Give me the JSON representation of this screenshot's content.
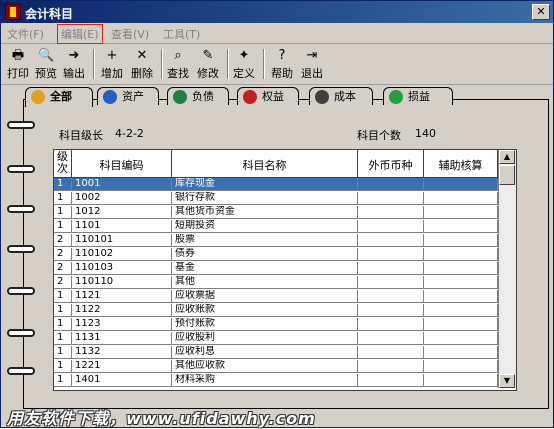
{
  "window": {
    "title": "会计科目",
    "close_label": "✕"
  },
  "menu": [
    {
      "label": "文件(F)"
    },
    {
      "label": "编辑(E)"
    },
    {
      "label": "查看(V)"
    },
    {
      "label": "工具(T)"
    }
  ],
  "toolbar": [
    {
      "label": "打印",
      "icon": "printer-icon",
      "glyph": "🖶"
    },
    {
      "label": "预览",
      "icon": "preview-icon",
      "glyph": "🔍"
    },
    {
      "label": "输出",
      "icon": "export-icon",
      "glyph": "➜"
    },
    {
      "label": "增加",
      "icon": "add-icon",
      "glyph": "+"
    },
    {
      "label": "删除",
      "icon": "delete-icon",
      "glyph": "✕"
    },
    {
      "label": "查找",
      "icon": "find-icon",
      "glyph": "⌕"
    },
    {
      "label": "修改",
      "icon": "edit-icon",
      "glyph": "✎"
    },
    {
      "label": "定义",
      "icon": "define-icon",
      "glyph": "✦"
    },
    {
      "label": "帮助",
      "icon": "help-icon",
      "glyph": "?"
    },
    {
      "label": "退出",
      "icon": "exit-icon",
      "glyph": "⇥"
    }
  ],
  "tabs": [
    {
      "label": "全部",
      "color": "#e0a020"
    },
    {
      "label": "资产",
      "color": "#2060c0"
    },
    {
      "label": "负债",
      "color": "#208040"
    },
    {
      "label": "权益",
      "color": "#c02020"
    },
    {
      "label": "成本",
      "color": "#404040"
    },
    {
      "label": "损益",
      "color": "#20a040"
    }
  ],
  "info": {
    "level_label": "科目级长",
    "level_value": "4-2-2",
    "count_label": "科目个数",
    "count_value": "140"
  },
  "columns": {
    "level": "级次",
    "code": "科目编码",
    "name": "科目名称",
    "currency": "外币币种",
    "aux": "辅助核算"
  },
  "rows": [
    {
      "level": "1",
      "code": "1001",
      "name": "库存现金"
    },
    {
      "level": "1",
      "code": "1002",
      "name": "银行存款"
    },
    {
      "level": "1",
      "code": "1012",
      "name": "其他货币资金"
    },
    {
      "level": "1",
      "code": "1101",
      "name": "短期投资"
    },
    {
      "level": "2",
      "code": "110101",
      "name": "  股票"
    },
    {
      "level": "2",
      "code": "110102",
      "name": "  债券"
    },
    {
      "level": "2",
      "code": "110103",
      "name": "  基金"
    },
    {
      "level": "2",
      "code": "110110",
      "name": "  其他"
    },
    {
      "level": "1",
      "code": "1121",
      "name": "应收票据"
    },
    {
      "level": "1",
      "code": "1122",
      "name": "应收账款"
    },
    {
      "level": "1",
      "code": "1123",
      "name": "预付账款"
    },
    {
      "level": "1",
      "code": "1131",
      "name": "应收股利"
    },
    {
      "level": "1",
      "code": "1132",
      "name": "应收利息"
    },
    {
      "level": "1",
      "code": "1221",
      "name": "其他应收款"
    },
    {
      "level": "1",
      "code": "1401",
      "name": "材料采购"
    }
  ],
  "watermark": "用友软件下载，www.ufidawhy.com"
}
